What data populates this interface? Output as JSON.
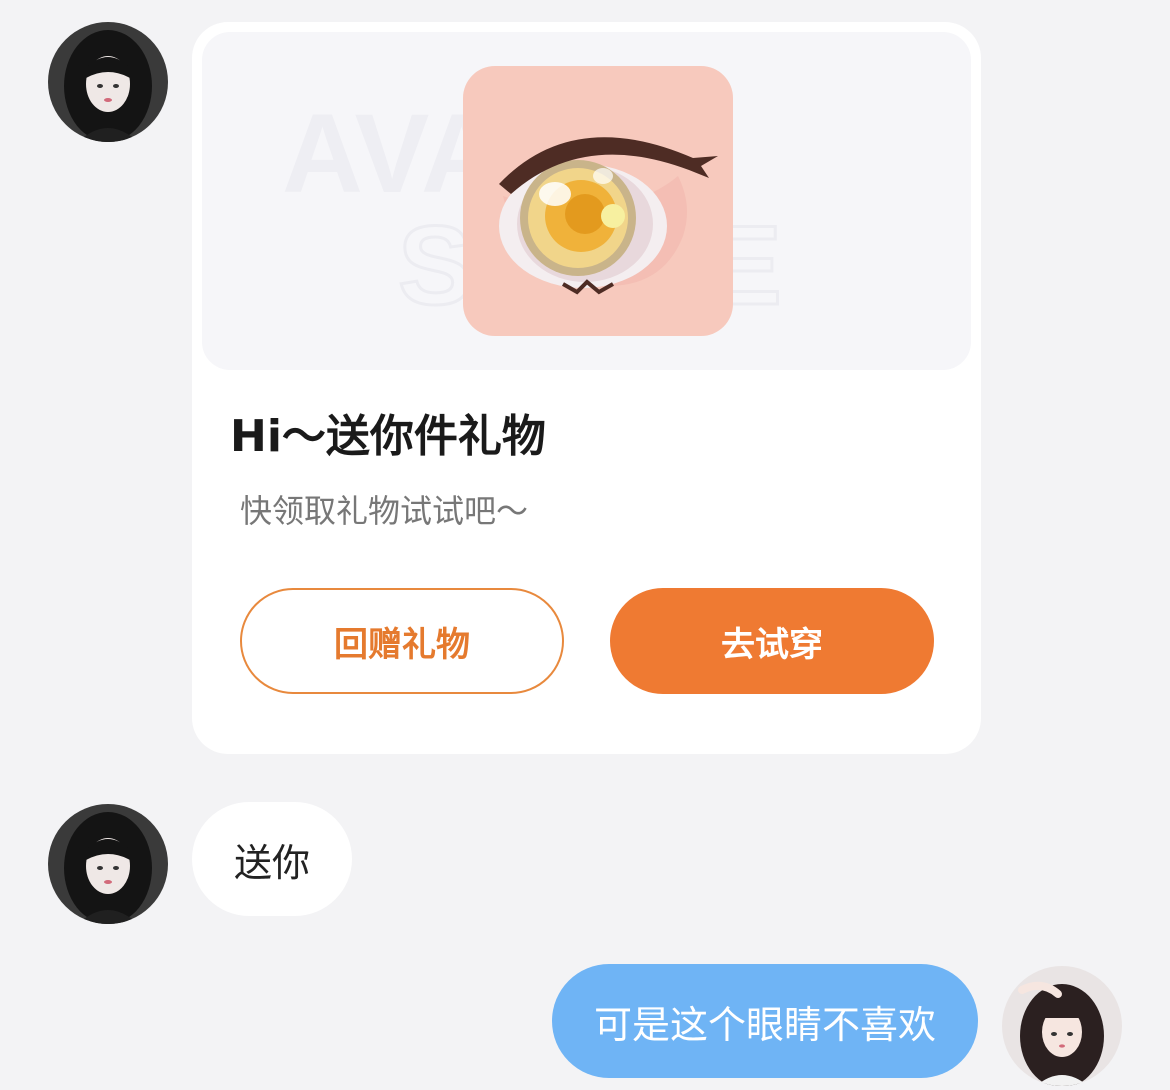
{
  "gift_card": {
    "banner_watermark": [
      "AVATAR",
      "STORE"
    ],
    "title": "Hi～送你件礼物",
    "subtitle": "快领取礼物试试吧～",
    "return_gift_label": "回赠礼物",
    "try_on_label": "去试穿"
  },
  "messages": {
    "incoming": "送你",
    "outgoing": "可是这个眼睛不喜欢"
  },
  "colors": {
    "accent": "#ef7a32",
    "outgoing_bubble": "#6fb4f5",
    "background": "#f3f3f5"
  }
}
